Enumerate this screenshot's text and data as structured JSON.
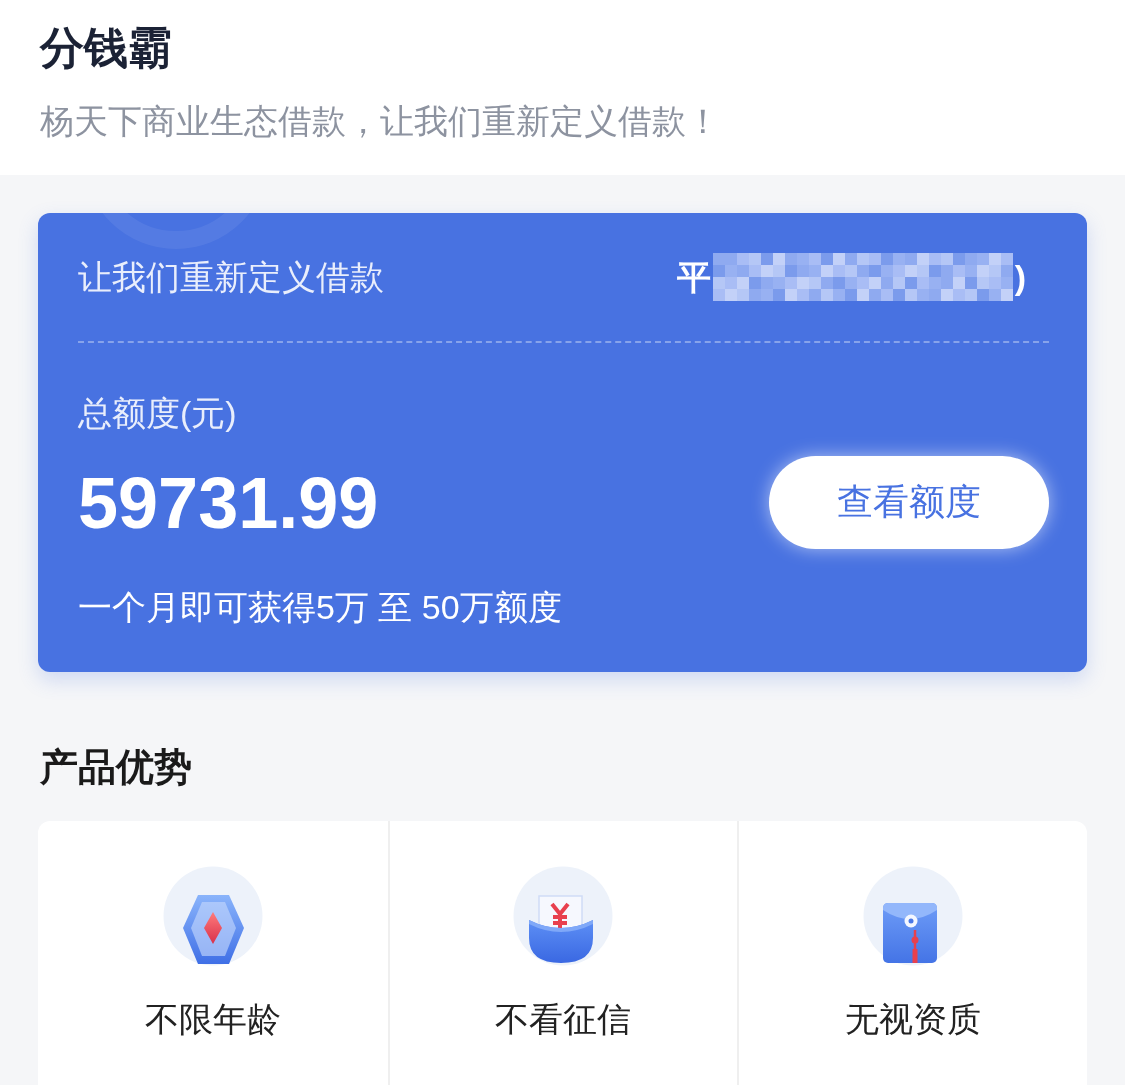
{
  "header": {
    "title": "分钱霸",
    "subtitle": "杨天下商业生态借款，让我们重新定义借款！"
  },
  "credit_card": {
    "slogan": "让我们重新定义借款",
    "account": {
      "prefix": "平",
      "suffix": ")"
    },
    "limit_label": "总额度(元)",
    "amount": "59731.99",
    "button": "查看额度",
    "note": "一个月即可获得5万 至 50万额度"
  },
  "advantages": {
    "title": "产品优势",
    "items": [
      {
        "kind": "gem",
        "label": "不限年龄"
      },
      {
        "kind": "wallet",
        "label": "不看征信"
      },
      {
        "kind": "envelope",
        "label": "无视资质"
      }
    ]
  }
}
